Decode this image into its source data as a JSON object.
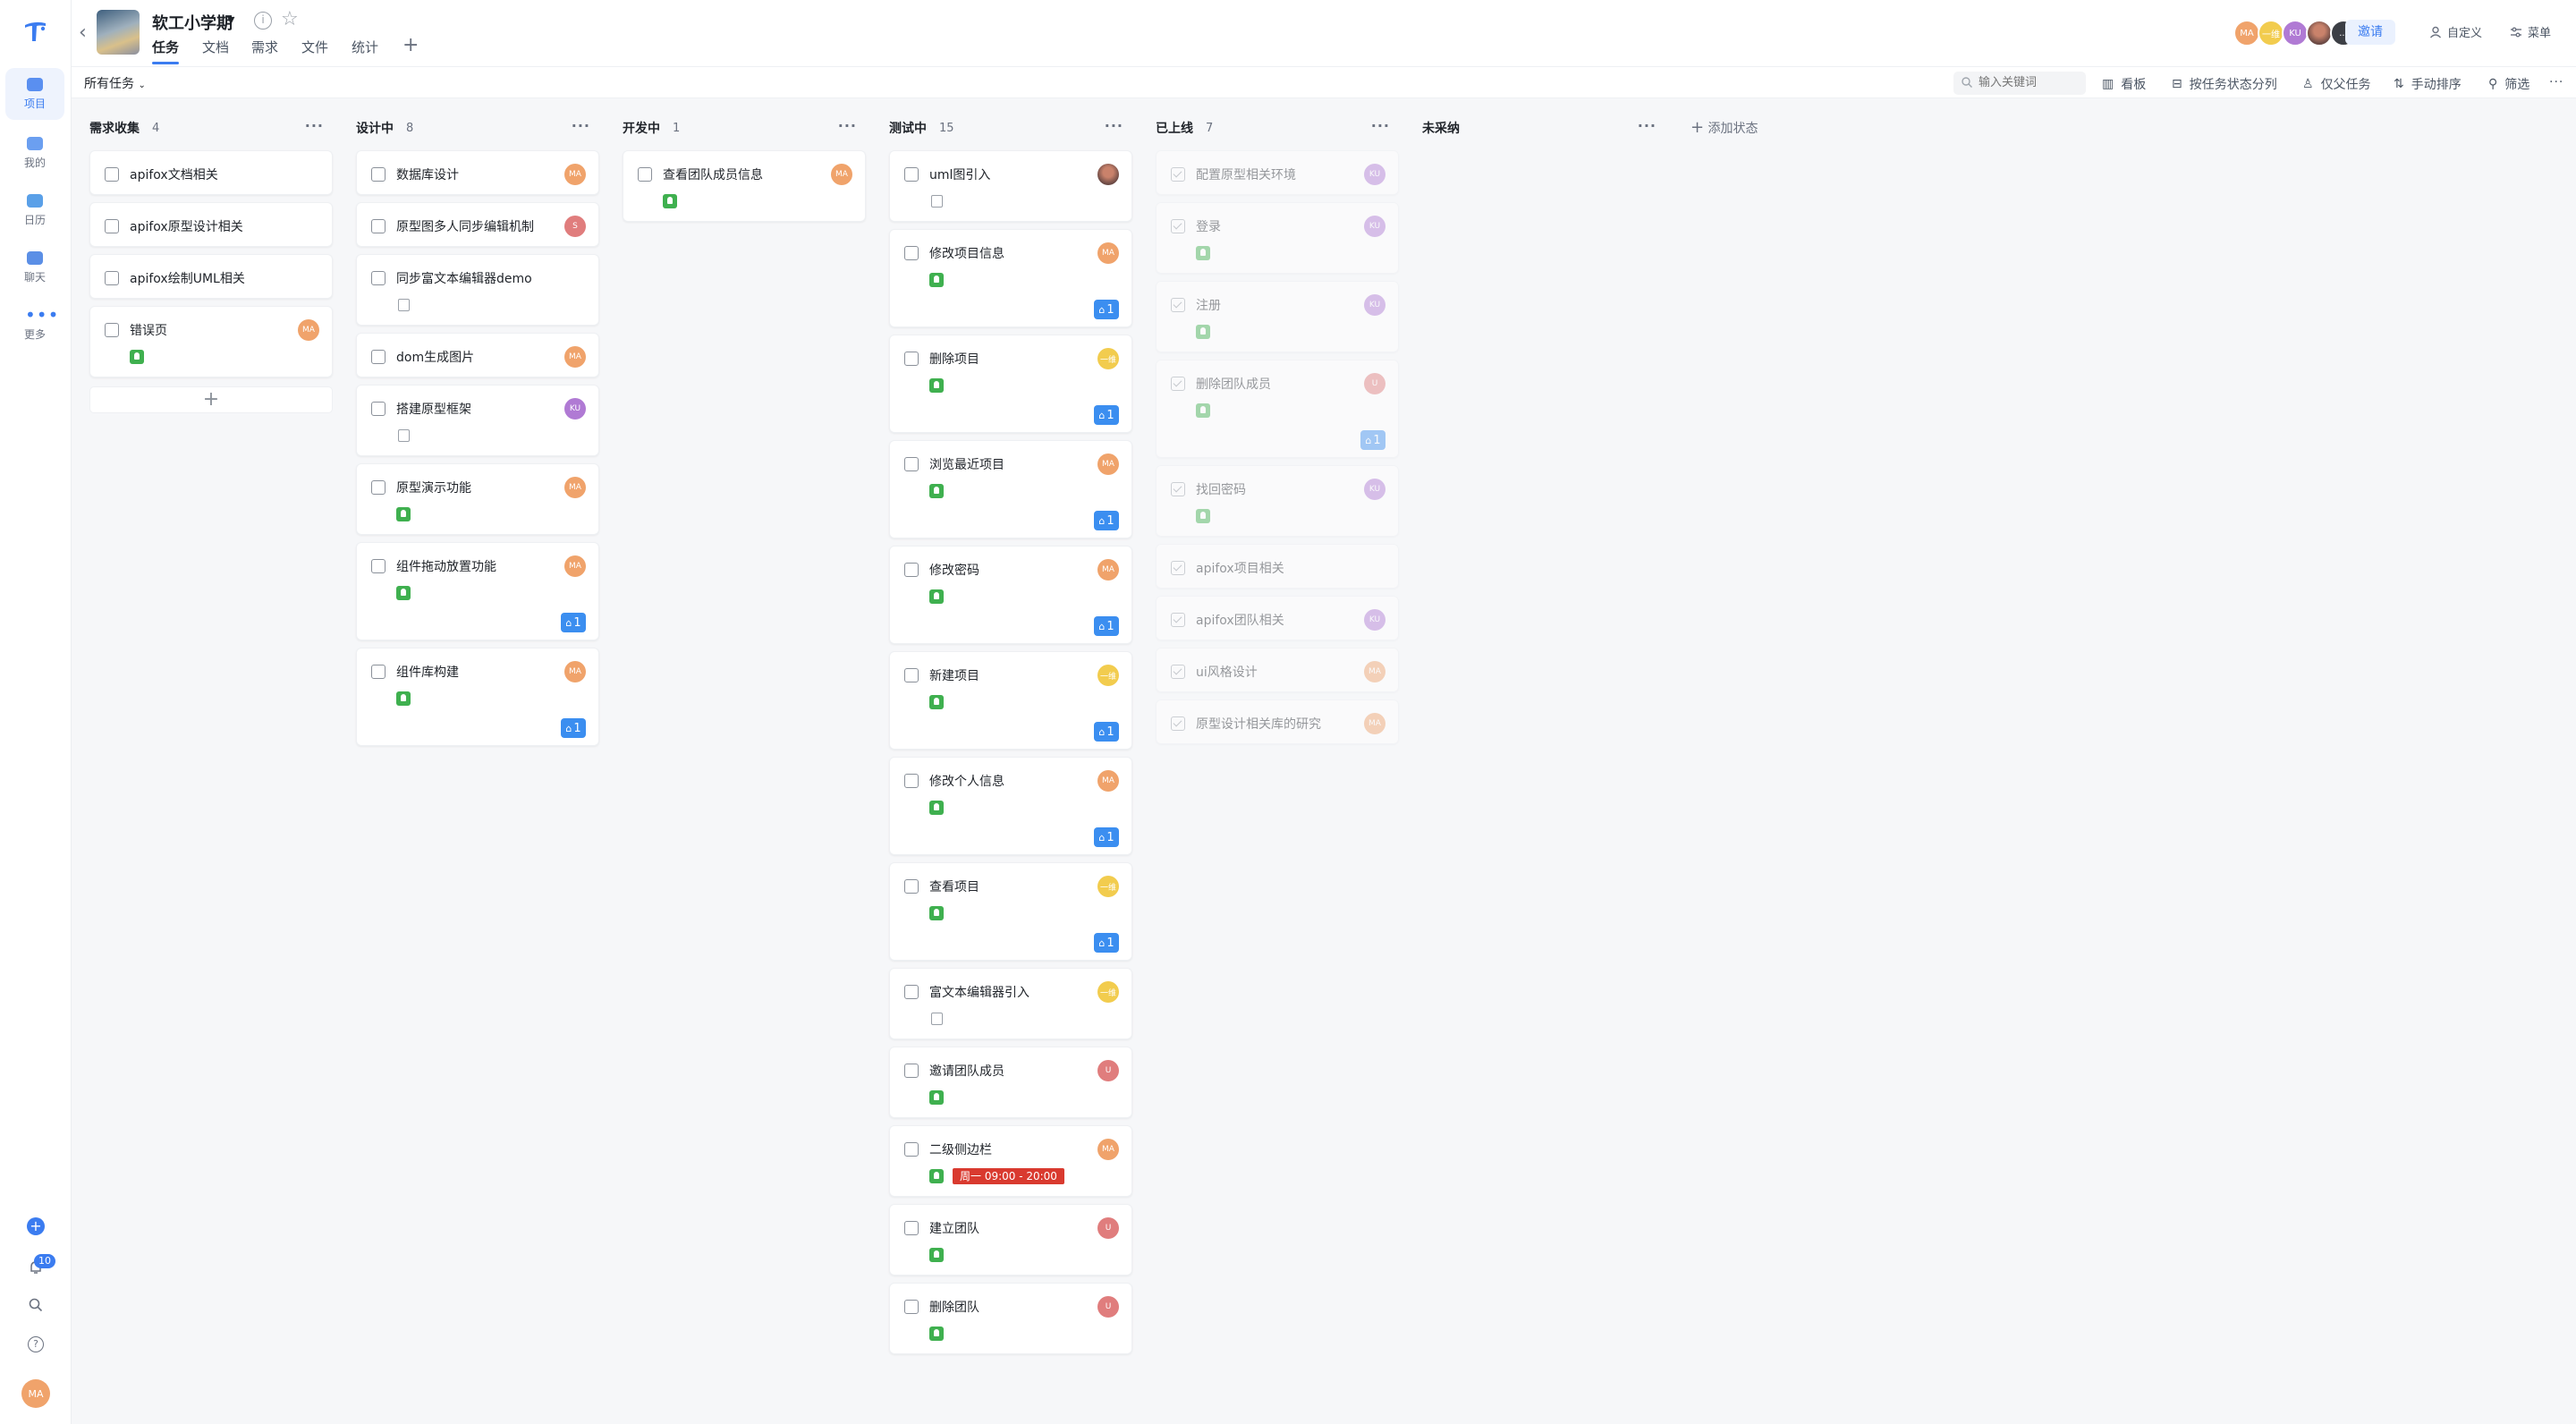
{
  "sidebar": {
    "nav": [
      {
        "label": "项目",
        "icon": "project-icon",
        "active": true
      },
      {
        "label": "我的",
        "icon": "my-icon",
        "active": false
      },
      {
        "label": "日历",
        "icon": "calendar-icon",
        "active": false
      },
      {
        "label": "聊天",
        "icon": "chat-icon",
        "active": false
      },
      {
        "label": "更多",
        "icon": "more-icon",
        "active": false
      }
    ],
    "notification_count": "10",
    "user_avatar": "MA"
  },
  "header": {
    "project_name": "软工小学期",
    "tabs": [
      "任务",
      "文档",
      "需求",
      "文件",
      "统计"
    ],
    "active_tab": "任务",
    "members": [
      "MA",
      "一维",
      "KU",
      "",
      "..."
    ],
    "invite_label": "邀请",
    "customize_label": "自定义",
    "menu_label": "菜单"
  },
  "toolbar": {
    "filter_label": "所有任务",
    "search_placeholder": "输入关键词",
    "board_label": "看板",
    "split_label": "按任务状态分列",
    "parent_only_label": "仅父任务",
    "sort_label": "手动排序",
    "filter_btn_label": "筛选"
  },
  "add_status_label": "添加状态",
  "colors": {
    "accent": "#3b7cf0",
    "tag_green": "#3fb04f",
    "date_red": "#d93a2f",
    "count_blue": "#3b8ef0"
  },
  "columns": [
    {
      "name": "需求收集",
      "count": "4",
      "cards": [
        {
          "title": "apifox文档相关"
        },
        {
          "title": "apifox原型设计相关"
        },
        {
          "title": "apifox绘制UML相关"
        },
        {
          "title": "错误页",
          "avatar": "MA",
          "avatar_color": "orange",
          "tag": true
        }
      ]
    },
    {
      "name": "设计中",
      "count": "8",
      "cards": [
        {
          "title": "数据库设计",
          "avatar": "MA",
          "avatar_color": "orange"
        },
        {
          "title": "原型图多人同步编辑机制",
          "avatar": "S",
          "avatar_color": "red"
        },
        {
          "title": "同步富文本编辑器demo",
          "note": true
        },
        {
          "title": "dom生成图片",
          "avatar": "MA",
          "avatar_color": "orange"
        },
        {
          "title": "搭建原型框架",
          "avatar": "KU",
          "avatar_color": "purple",
          "note": true
        },
        {
          "title": "原型演示功能",
          "avatar": "MA",
          "avatar_color": "orange",
          "tag": true
        },
        {
          "title": "组件拖动放置功能",
          "avatar": "MA",
          "avatar_color": "orange",
          "tag": true,
          "subtasks": "1"
        },
        {
          "title": "组件库构建",
          "avatar": "MA",
          "avatar_color": "orange",
          "tag": true,
          "subtasks": "1"
        }
      ]
    },
    {
      "name": "开发中",
      "count": "1",
      "cards": [
        {
          "title": "查看团队成员信息",
          "avatar": "MA",
          "avatar_color": "orange",
          "tag": true
        }
      ]
    },
    {
      "name": "测试中",
      "count": "15",
      "cards": [
        {
          "title": "uml图引入",
          "avatar": "",
          "avatar_color": "photo",
          "note": true
        },
        {
          "title": "修改项目信息",
          "avatar": "MA",
          "avatar_color": "orange",
          "tag": true,
          "subtasks": "1"
        },
        {
          "title": "删除项目",
          "avatar": "一维",
          "avatar_color": "yellow",
          "tag": true,
          "subtasks": "1"
        },
        {
          "title": "浏览最近项目",
          "avatar": "MA",
          "avatar_color": "orange",
          "tag": true,
          "subtasks": "1"
        },
        {
          "title": "修改密码",
          "avatar": "MA",
          "avatar_color": "orange",
          "tag": true,
          "subtasks": "1"
        },
        {
          "title": "新建项目",
          "avatar": "一维",
          "avatar_color": "yellow",
          "tag": true,
          "subtasks": "1"
        },
        {
          "title": "修改个人信息",
          "avatar": "MA",
          "avatar_color": "orange",
          "tag": true,
          "subtasks": "1"
        },
        {
          "title": "查看项目",
          "avatar": "一维",
          "avatar_color": "yellow",
          "tag": true,
          "subtasks": "1"
        },
        {
          "title": "富文本编辑器引入",
          "avatar": "一维",
          "avatar_color": "yellow",
          "note": true
        },
        {
          "title": "邀请团队成员",
          "avatar": "U",
          "avatar_color": "red",
          "tag": true
        },
        {
          "title": "二级侧边栏",
          "avatar": "MA",
          "avatar_color": "orange",
          "tag": true,
          "date": "周一 09:00 - 20:00"
        },
        {
          "title": "建立团队",
          "avatar": "U",
          "avatar_color": "red",
          "tag": true
        },
        {
          "title": "删除团队",
          "avatar": "U",
          "avatar_color": "red",
          "tag": true
        }
      ]
    },
    {
      "name": "已上线",
      "count": "7",
      "done": true,
      "cards": [
        {
          "title": "配置原型相关环境",
          "avatar": "KU",
          "avatar_color": "purple"
        },
        {
          "title": "登录",
          "avatar": "KU",
          "avatar_color": "purple",
          "tag": true
        },
        {
          "title": "注册",
          "avatar": "KU",
          "avatar_color": "purple",
          "tag": true
        },
        {
          "title": "删除团队成员",
          "avatar": "U",
          "avatar_color": "red",
          "tag": true,
          "subtasks": "1"
        },
        {
          "title": "找回密码",
          "avatar": "KU",
          "avatar_color": "purple",
          "tag": true
        },
        {
          "title": "apifox项目相关"
        },
        {
          "title": "apifox团队相关",
          "avatar": "KU",
          "avatar_color": "purple"
        },
        {
          "title": "ui风格设计",
          "avatar": "MA",
          "avatar_color": "orange"
        },
        {
          "title": "原型设计相关库的研究",
          "avatar": "MA",
          "avatar_color": "orange"
        }
      ]
    },
    {
      "name": "未采纳",
      "count": "",
      "cards": []
    }
  ]
}
